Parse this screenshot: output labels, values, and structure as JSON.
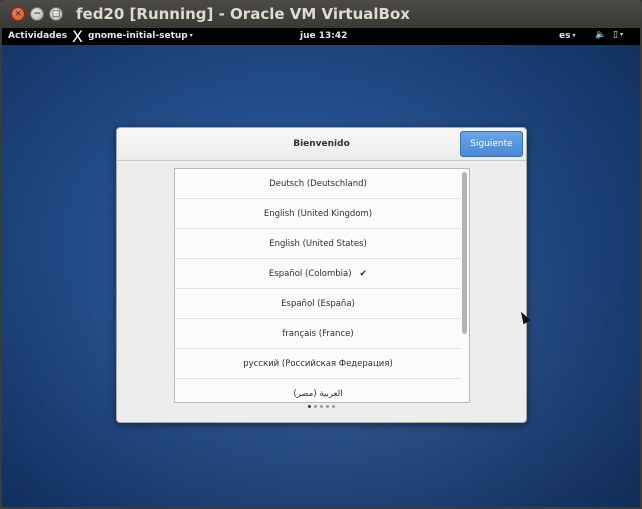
{
  "host_window": {
    "title": "fed20 [Running] - Oracle VM VirtualBox",
    "buttons": {
      "close_glyph": "×",
      "minimize_glyph": "−",
      "maximize_glyph": "□"
    }
  },
  "gnome_topbar": {
    "activities": "Actividades",
    "app_menu": "gnome-initial-setup",
    "app_menu_arrow": "▾",
    "clock": "jue 13:42",
    "language": "es",
    "language_arrow": "▾",
    "sound_icon": "🔈",
    "power_icon": "▯",
    "power_arrow": "▾",
    "app_icon_glyph": "X"
  },
  "setup_dialog": {
    "title": "Bienvenido",
    "next_button": "Siguiente",
    "languages": [
      {
        "label": "Deutsch (Deutschland)",
        "selected": false
      },
      {
        "label": "English (United Kingdom)",
        "selected": false
      },
      {
        "label": "English (United States)",
        "selected": false
      },
      {
        "label": "Español (Colombia)",
        "selected": true
      },
      {
        "label": "Español (España)",
        "selected": false
      },
      {
        "label": "français (France)",
        "selected": false
      },
      {
        "label": "русский (Российская Федерация)",
        "selected": false
      },
      {
        "label": "العربية (مصر)",
        "selected": false
      }
    ],
    "check_glyph": "✔",
    "page_dots": {
      "total": 5,
      "active": 1
    }
  },
  "colors": {
    "accent_button": "#4a89d7",
    "desktop_blue": "#234c87",
    "topbar": "#000000"
  }
}
